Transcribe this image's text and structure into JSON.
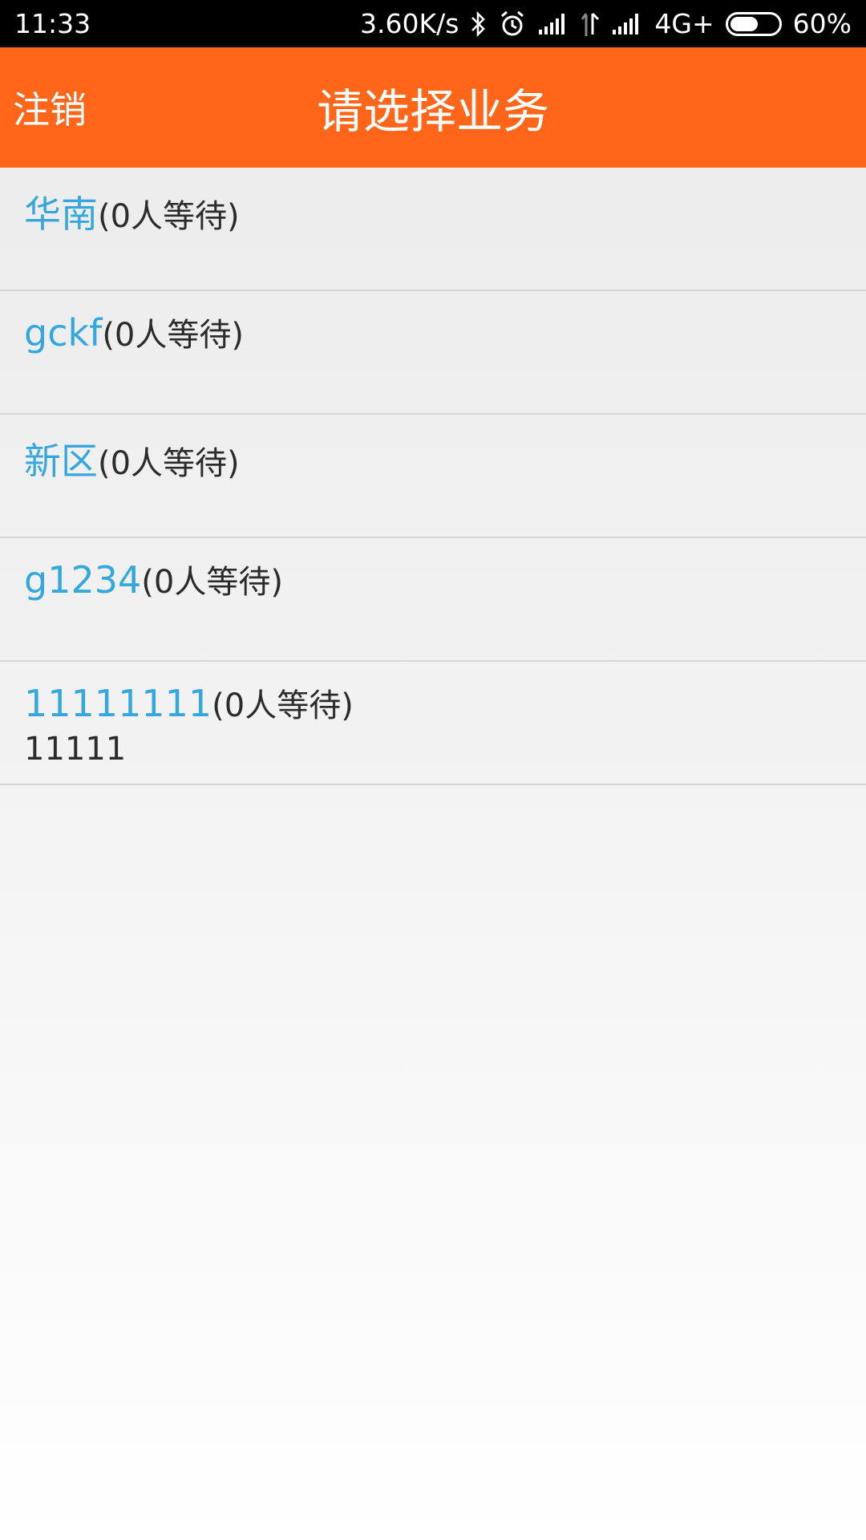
{
  "status_bar": {
    "time": "11:33",
    "speed": "3.60K/s",
    "network": "4G+",
    "battery": "60%",
    "battery_level": 0.6,
    "icons": [
      "bluetooth-icon",
      "alarm-icon",
      "signal-icon",
      "data-arrows-icon",
      "signal-icon"
    ]
  },
  "header": {
    "logout_label": "注销",
    "title": "请选择业务",
    "background_color": "#ff661a"
  },
  "services": [
    {
      "name": "华南",
      "wait": "(0人等待)",
      "desc": ""
    },
    {
      "name": "gckf",
      "wait": "(0人等待)",
      "desc": ""
    },
    {
      "name": "新区",
      "wait": "(0人等待)",
      "desc": ""
    },
    {
      "name": "g1234",
      "wait": "(0人等待)",
      "desc": ""
    },
    {
      "name": "11111111",
      "wait": "(0人等待)",
      "desc": "11111"
    }
  ],
  "colors": {
    "accent_name": "#35a7de",
    "text": "#2b2b2b"
  }
}
